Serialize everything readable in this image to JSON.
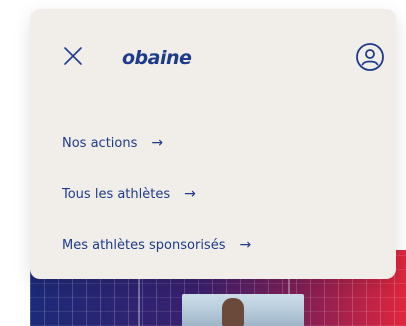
{
  "brand": {
    "logo_text": "obaine"
  },
  "header": {
    "close_icon": "close-icon",
    "account_icon": "user-circle-icon"
  },
  "menu": {
    "items": [
      {
        "label": "Nos actions",
        "arrow": "→"
      },
      {
        "label": "Tous les athlètes",
        "arrow": "→"
      },
      {
        "label": "Mes athlètes sponsorisés",
        "arrow": "→"
      }
    ]
  },
  "colors": {
    "panel": "#f1eeea",
    "primary": "#1e3a8a",
    "hero_left": "#1c2a78",
    "hero_right": "#e0263e"
  }
}
